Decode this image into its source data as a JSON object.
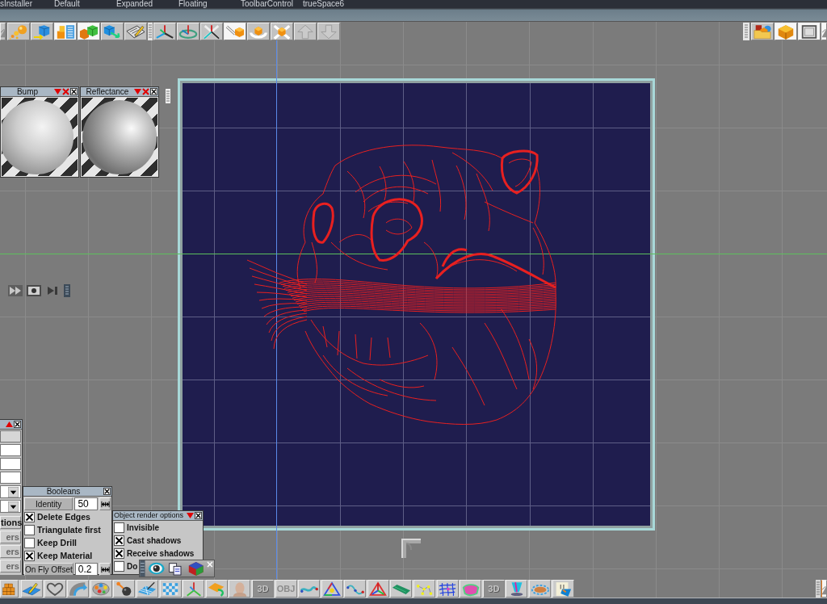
{
  "menu_tabs": [
    {
      "label": "sInstaller"
    },
    {
      "label": "Default"
    },
    {
      "label": "Expanded"
    },
    {
      "label": "Floating"
    },
    {
      "label": "ToolbarControl"
    },
    {
      "label": "trueSpace6"
    }
  ],
  "top_toolbar": {
    "groups": [
      {
        "tools": [
          {
            "kind": "edge",
            "selected": false
          },
          {
            "kind": "spheres",
            "selected": false
          },
          {
            "kind": "cube-arrow",
            "selected": false
          },
          {
            "kind": "object-panel",
            "selected": true
          },
          {
            "kind": "cubes-pair",
            "selected": true
          },
          {
            "kind": "cube-move",
            "selected": false
          },
          {
            "kind": "pencil-paper",
            "selected": false
          }
        ]
      },
      {
        "tools": [
          {
            "kind": "axes",
            "selected": false
          },
          {
            "kind": "rotate-ring",
            "selected": false
          },
          {
            "kind": "scale-axes",
            "selected": false
          },
          {
            "kind": "move-cube",
            "selected": true
          },
          {
            "kind": "rotate-cube",
            "selected": false
          },
          {
            "kind": "scale-cube",
            "selected": false
          },
          {
            "kind": "arrow-up",
            "selected": false
          },
          {
            "kind": "arrow-down",
            "selected": false
          }
        ]
      }
    ]
  },
  "right_toolbar": {
    "tools": [
      {
        "kind": "folder",
        "selected": false
      },
      {
        "kind": "cube",
        "selected": true
      },
      {
        "kind": "square",
        "selected": true
      },
      {
        "kind": "edge",
        "selected": true
      }
    ]
  },
  "material_panels": [
    {
      "title": "Bump",
      "kind": "bump"
    },
    {
      "title": "Reflectance",
      "kind": "reflectance"
    }
  ],
  "playback_controls": [
    {
      "kind": "fast-forward"
    },
    {
      "kind": "record"
    },
    {
      "kind": "skip-next"
    }
  ],
  "side_panel": {
    "fields": [
      {
        "disabled": true
      },
      {
        "disabled": false
      },
      {
        "disabled": false
      },
      {
        "disabled": false
      }
    ],
    "buttons": [
      {
        "label": "tions",
        "disabled": false
      },
      {
        "label": "ers",
        "disabled": true
      },
      {
        "label": "ers",
        "disabled": true
      },
      {
        "label": "ers",
        "disabled": true
      }
    ]
  },
  "booleans": {
    "title": "Booleans",
    "identity": {
      "label": "Identity",
      "value": "50"
    },
    "options": [
      {
        "label": "Delete Edges",
        "checked": true
      },
      {
        "label": "Triangulate first",
        "checked": false
      },
      {
        "label": "Keep Drill",
        "checked": false
      },
      {
        "label": "Keep Material",
        "checked": true
      }
    ],
    "offset": {
      "label": "On Fly Offset",
      "value": "0.2"
    }
  },
  "render_options": {
    "title": "Object render options",
    "options": [
      {
        "label": "Invisible",
        "checked": false
      },
      {
        "label": "Cast shadows",
        "checked": true
      },
      {
        "label": "Receive shadows",
        "checked": true
      },
      {
        "label": "Do",
        "checked": false
      }
    ]
  },
  "floating_toolbar": [
    {
      "kind": "eye"
    },
    {
      "kind": "documents"
    },
    {
      "kind": "color-cube"
    }
  ],
  "bottom_toolbar": {
    "tools": [
      {
        "kind": "cubes-stack",
        "selected": false
      },
      {
        "kind": "pencil-plane",
        "selected": false
      },
      {
        "kind": "heart",
        "selected": false
      },
      {
        "kind": "arc",
        "selected": false
      },
      {
        "kind": "palette",
        "selected": false
      },
      {
        "kind": "ball-stick",
        "selected": false
      },
      {
        "kind": "checker-plane",
        "selected": false
      },
      {
        "kind": "checker",
        "selected": false
      },
      {
        "kind": "tripod",
        "selected": false
      },
      {
        "kind": "plane-arrow",
        "selected": false
      },
      {
        "kind": "head",
        "selected": false
      },
      {
        "kind": "emboss",
        "label": "3D",
        "selected": false
      },
      {
        "kind": "label",
        "label": "OBJ",
        "selected": false
      },
      {
        "kind": "curve",
        "selected": false
      },
      {
        "kind": "color-triangle",
        "selected": false
      },
      {
        "kind": "curve-points",
        "selected": false
      },
      {
        "kind": "triangle-axes",
        "selected": false
      },
      {
        "kind": "plank",
        "selected": false
      },
      {
        "kind": "points",
        "selected": false
      },
      {
        "kind": "mesh",
        "selected": false
      },
      {
        "kind": "blob",
        "selected": false
      },
      {
        "kind": "emboss",
        "label": "3D",
        "selected": false
      },
      {
        "kind": "cup",
        "selected": false
      },
      {
        "kind": "plate",
        "selected": false
      },
      {
        "kind": "plug",
        "selected": false
      }
    ]
  },
  "bottom_right_toolbar": {
    "tools": [
      {
        "kind": "edge",
        "selected": true
      }
    ]
  }
}
